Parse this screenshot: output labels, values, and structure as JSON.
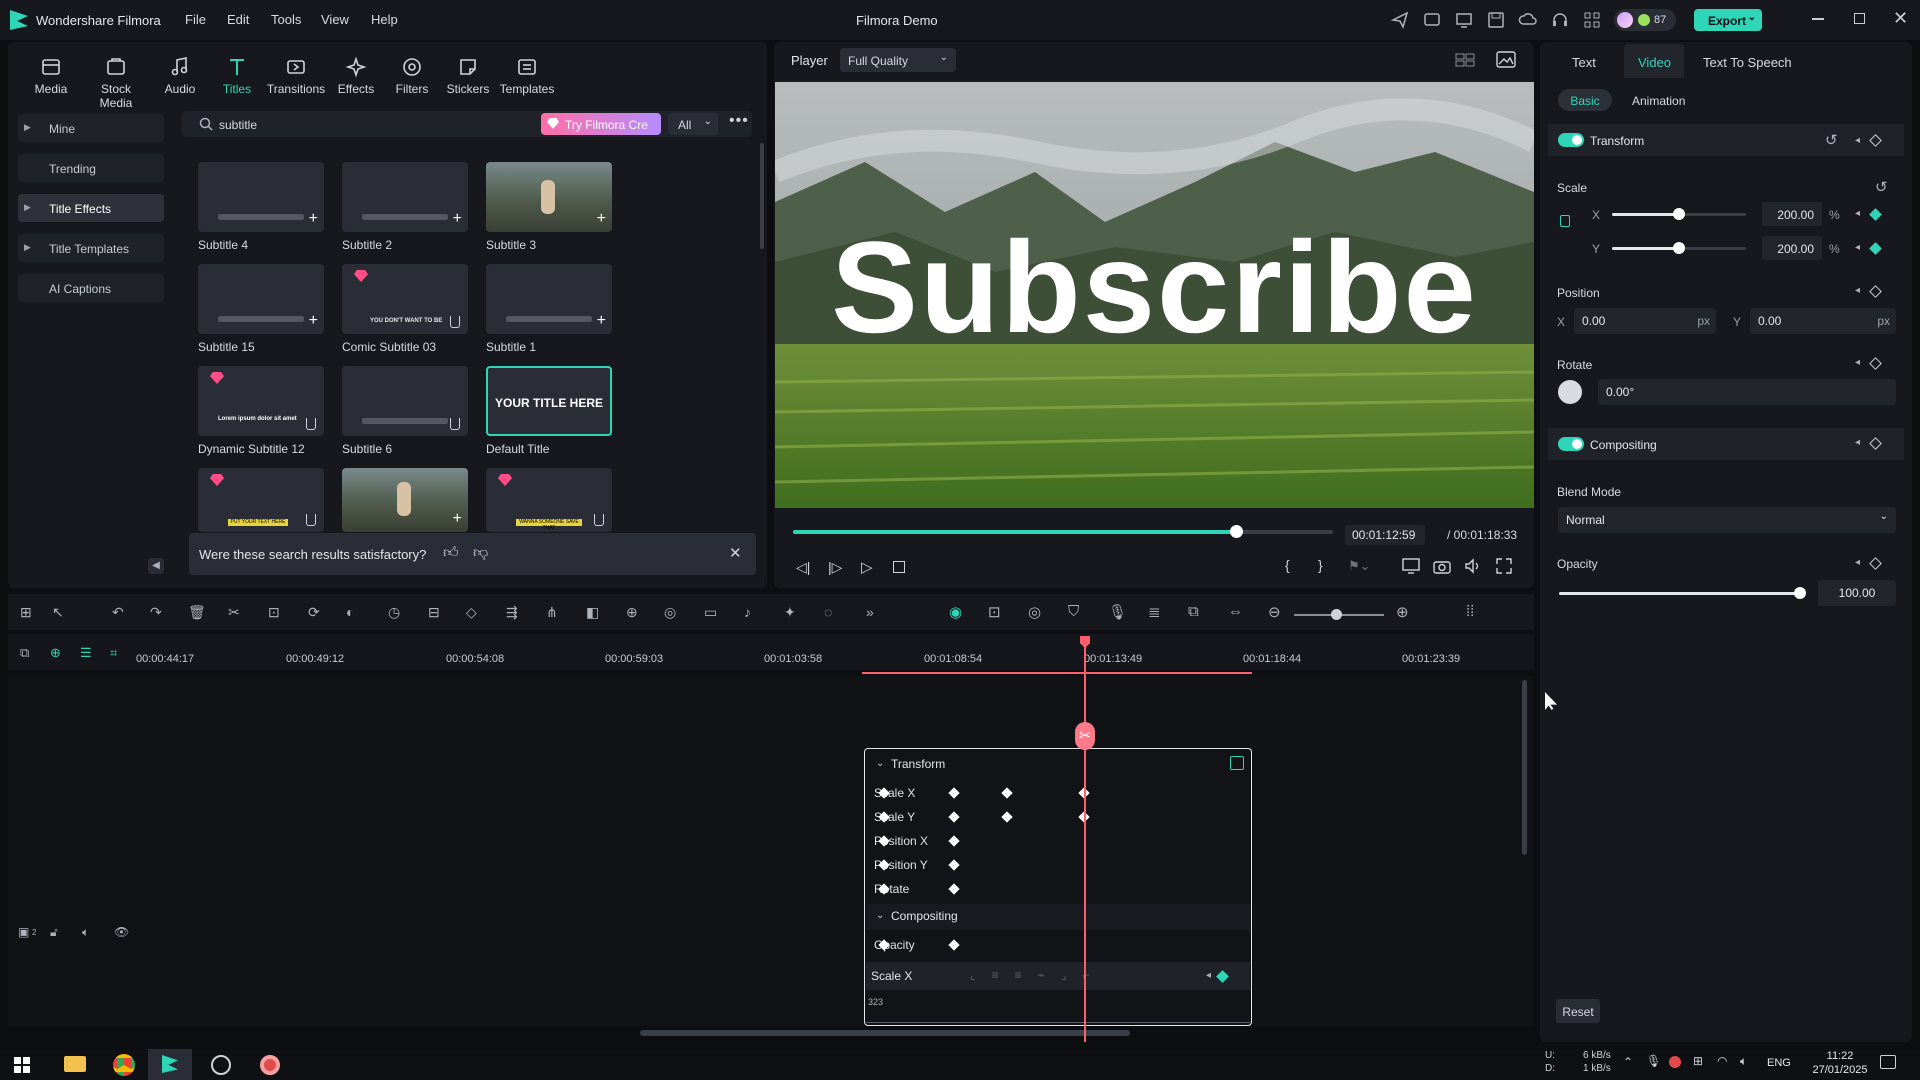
{
  "app": {
    "name": "Wondershare Filmora",
    "title": "Filmora Demo",
    "credits": "87",
    "export_label": "Export"
  },
  "menu": [
    "File",
    "Edit",
    "Tools",
    "View",
    "Help"
  ],
  "toolbar": [
    "Media",
    "Stock Media",
    "Audio",
    "Titles",
    "Transitions",
    "Effects",
    "Filters",
    "Stickers",
    "Templates"
  ],
  "sidebar": [
    "Mine",
    "Trending",
    "Title Effects",
    "Title Templates",
    "AI Captions"
  ],
  "search": {
    "value": "subtitle",
    "promo": "Try Filmora Cre",
    "filter": "All"
  },
  "cards": [
    "Subtitle 4",
    "Subtitle 2",
    "Subtitle 3",
    "Subtitle 15",
    "Comic Subtitle 03",
    "Subtitle 1",
    "Dynamic Subtitle 12",
    "Subtitle 6",
    "Default Title"
  ],
  "card_texts": {
    "comic": "YOU DON'T WANT TO BE",
    "default": "YOUR TITLE HERE",
    "dynamic": "Lorem ipsum dolor sit amet",
    "put": "PUT YOUR TEXT HERE",
    "wanna": "WANNA SOMEONE SAVE THAT"
  },
  "feedback": "Were these search results satisfactory?",
  "player": {
    "label": "Player",
    "quality": "Full Quality",
    "overlay_text": "Subscribe",
    "current": "00:01:12:59",
    "total": "/ 00:01:18:33",
    "progress": 0.82
  },
  "tabs": [
    "Text",
    "Video",
    "Text To Speech"
  ],
  "subtabs": [
    "Basic",
    "Animation"
  ],
  "props": {
    "transform": "Transform",
    "scale": "Scale",
    "x": "X",
    "y": "Y",
    "scale_x": "200.00",
    "scale_y": "200.00",
    "percent": "%",
    "position": "Position",
    "pos_x": "0.00",
    "pos_y": "0.00",
    "px": "px",
    "rotate": "Rotate",
    "rotate_val": "0.00°",
    "compositing": "Compositing",
    "blend_mode": "Blend Mode",
    "blend_value": "Normal",
    "opacity": "Opacity",
    "opacity_val": "100.00",
    "reset": "Reset"
  },
  "timeline": {
    "ticks": [
      "00:00:44:17",
      "00:00:49:12",
      "00:00:54:08",
      "00:00:59:03",
      "00:01:03:58",
      "00:01:08:54",
      "00:01:13:49",
      "00:01:18:44",
      "00:01:23:39"
    ],
    "track_count": "2"
  },
  "keyframe_panel": {
    "transform": "Transform",
    "rows": [
      "Scale X",
      "Scale Y",
      "Position X",
      "Position Y",
      "Rotate"
    ],
    "compositing": "Compositing",
    "opacity": "Opacity",
    "graph_label": "Scale X",
    "graph_value": "323"
  },
  "taskbar": {
    "upload": "U:",
    "download": "D:",
    "up_speed": "6 kB/s",
    "down_speed": "1 kB/s",
    "lang": "ENG",
    "time": "11:22",
    "date": "27/01/2025"
  },
  "colors": {
    "accent": "#2fd5b7",
    "playhead": "#ff5c6c",
    "panel": "#16181d"
  }
}
